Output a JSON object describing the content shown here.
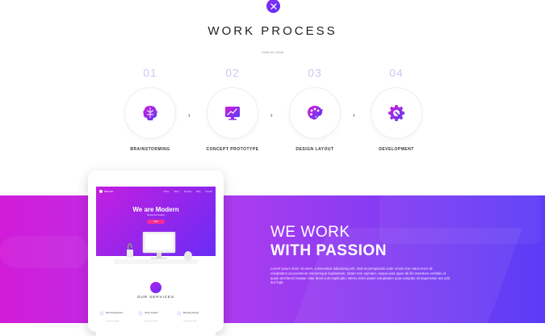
{
  "header": {
    "badge_icon": "tools-icon"
  },
  "section": {
    "title": "WORK PROCESS",
    "subtitle": "Show the Work"
  },
  "steps": [
    {
      "number": "01",
      "label": "BRAINSTORMING",
      "icon": "brain-icon"
    },
    {
      "number": "02",
      "label": "CONCEPT PROTOTYPE",
      "icon": "monitor-chart-icon"
    },
    {
      "number": "03",
      "label": "DESIGN LAYOUT",
      "icon": "palette-icon"
    },
    {
      "number": "04",
      "label": "DEVELOPMENT",
      "icon": "gear-icon"
    }
  ],
  "arrow_glyph": "›",
  "passion": {
    "line1": "WE WORK",
    "line2": "WITH PASSION",
    "body": "Lorem ipsum dolor sit amet, consectetur adipisicing elit. Sed ut perspiciatis unde omnis iste natus error sit voluptatem accusantium doloremque laudantium, totam rem aperiam, eaque ipsa quae ab illo inventore veritatis et quasi architecto beatae vitae dicta sunt explicabo. Nemo enim ipsam voluptatem quia voluptas sit aspernatur aut odit aut fugit."
  },
  "tablet": {
    "brand": "Maxweb",
    "menu": [
      "Home",
      "About",
      "Services",
      "Blog",
      "Contact"
    ],
    "hero_title": "We are Modern",
    "hero_sub": "Simple and creative",
    "hero_button": "Start",
    "services_title": "OUR SERVICES",
    "cards": [
      {
        "title": "Web Development",
        "desc": "Lorem ipsum dolor"
      },
      {
        "title": "Vision Graphic",
        "desc": "Lorem ipsum dolor"
      },
      {
        "title": "Branding Design",
        "desc": "Lorem ipsum dolor"
      }
    ]
  },
  "colors": {
    "accent": "#7b2cf2",
    "band_start": "#d21cd9",
    "band_end": "#5b3cf6",
    "step_number": "#cfc7f4"
  }
}
